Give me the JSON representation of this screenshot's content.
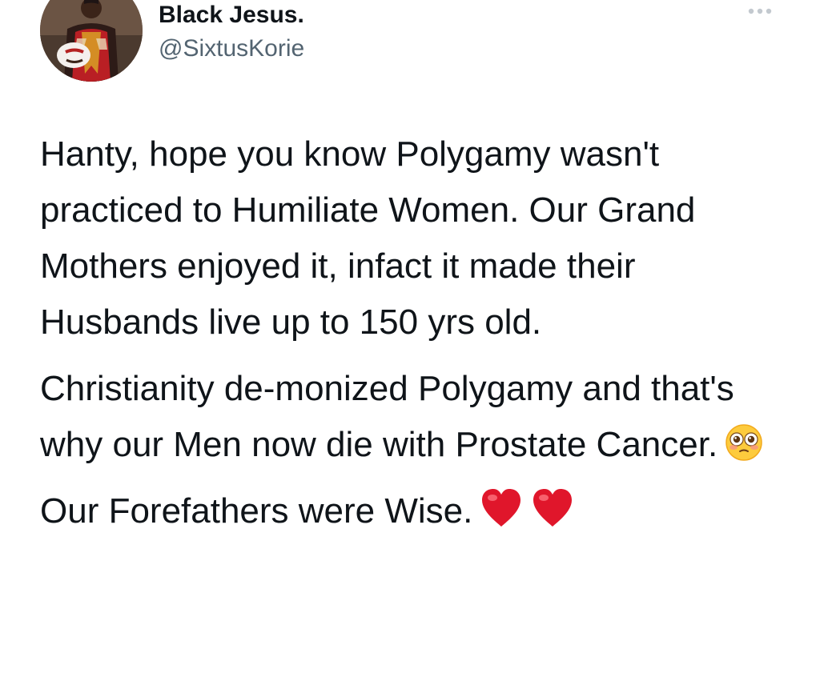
{
  "tweet": {
    "author": {
      "display_name": "Black Jesus.",
      "handle": "@SixtusKorie",
      "avatar_icon": "profile-photo"
    },
    "more_icon": "ellipsis-icon",
    "paragraphs": [
      "Hanty, hope you know Polygamy wasn't practiced to Humiliate Women. Our Grand Mothers enjoyed it, infact it made their Husbands live up to 150 yrs old.",
      "Christianity de-monized Polygamy and that's why our Men now die with Prostate Cancer.",
      "Our Forefathers were Wise."
    ],
    "emojis": {
      "paragraph_2": "flushed-face-emoji",
      "paragraph_3": [
        "red-heart-emoji",
        "red-heart-emoji"
      ]
    }
  },
  "colors": {
    "text": "#0f1419",
    "secondary_text": "#536471",
    "background": "#ffffff",
    "heart": "#e0162b",
    "emoji_face": "#fdcb3d"
  }
}
